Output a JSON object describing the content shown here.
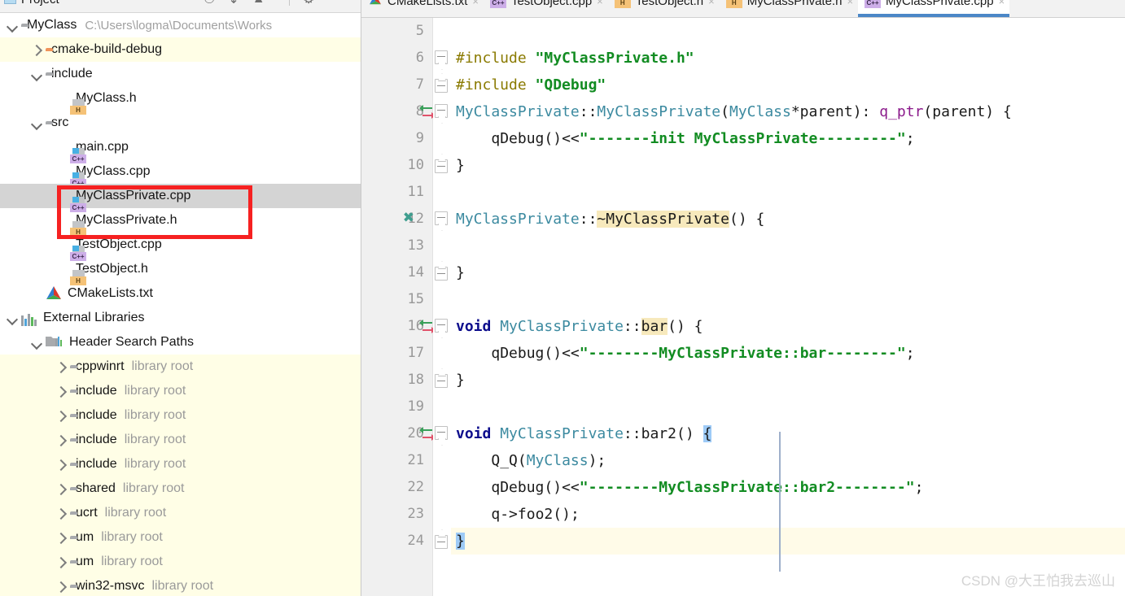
{
  "toolwindow": {
    "title": "Project",
    "caret_icon": "chevron-down-icon",
    "actions": [
      "locate-icon",
      "collapse-all-icon",
      "expand-icon",
      "settings-gear-icon"
    ]
  },
  "project_tree": [
    {
      "id": "myclass",
      "depth": 0,
      "arrow": "down",
      "icon": "folder-gray",
      "label": "MyClass",
      "path": "C:\\Users\\logma\\Documents\\Works",
      "row": "plain"
    },
    {
      "id": "cmake-build-debug",
      "depth": 1,
      "arrow": "right",
      "icon": "folder-orange",
      "label": "cmake-build-debug",
      "path": "",
      "row": "yellow"
    },
    {
      "id": "include",
      "depth": 1,
      "arrow": "down",
      "icon": "folder-gray",
      "label": "include",
      "path": "",
      "row": "plain"
    },
    {
      "id": "myclass-h",
      "depth": 2,
      "arrow": "none",
      "icon": "file-h",
      "label": "MyClass.h",
      "path": "",
      "row": "plain"
    },
    {
      "id": "src",
      "depth": 1,
      "arrow": "down",
      "icon": "folder-gray",
      "label": "src",
      "path": "",
      "row": "plain"
    },
    {
      "id": "main-cpp",
      "depth": 2,
      "arrow": "none",
      "icon": "file-cpp",
      "label": "main.cpp",
      "path": "",
      "row": "plain"
    },
    {
      "id": "myclass-cpp",
      "depth": 2,
      "arrow": "none",
      "icon": "file-cpp",
      "label": "MyClass.cpp",
      "path": "",
      "row": "plain"
    },
    {
      "id": "myclassprivate-cpp",
      "depth": 2,
      "arrow": "none",
      "icon": "file-cpp",
      "label": "MyClassPrivate.cpp",
      "path": "",
      "row": "selected"
    },
    {
      "id": "myclassprivate-h",
      "depth": 2,
      "arrow": "none",
      "icon": "file-h",
      "label": "MyClassPrivate.h",
      "path": "",
      "row": "plain"
    },
    {
      "id": "testobject-cpp",
      "depth": 2,
      "arrow": "none",
      "icon": "file-cpp",
      "label": "TestObject.cpp",
      "path": "",
      "row": "plain"
    },
    {
      "id": "testobject-h",
      "depth": 2,
      "arrow": "none",
      "icon": "file-h",
      "label": "TestObject.h",
      "path": "",
      "row": "plain"
    },
    {
      "id": "cmakelists-txt",
      "depth": 1,
      "arrow": "none",
      "icon": "cmake",
      "label": "CMakeLists.txt",
      "path": "",
      "row": "plain"
    },
    {
      "id": "external-libraries",
      "depth": 0,
      "arrow": "down",
      "icon": "libraries",
      "label": "External Libraries",
      "path": "",
      "row": "plain"
    },
    {
      "id": "header-search-paths",
      "depth": 1,
      "arrow": "down",
      "icon": "hsp",
      "label": "Header Search Paths",
      "path": "",
      "row": "plain"
    },
    {
      "id": "lib-cppwinrt",
      "depth": 2,
      "arrow": "right",
      "icon": "folder-gray",
      "label": "cppwinrt",
      "sub": "library root",
      "row": "yellow"
    },
    {
      "id": "lib-include-1",
      "depth": 2,
      "arrow": "right",
      "icon": "folder-gray",
      "label": "include",
      "sub": "library root",
      "row": "yellow"
    },
    {
      "id": "lib-include-2",
      "depth": 2,
      "arrow": "right",
      "icon": "folder-gray",
      "label": "include",
      "sub": "library root",
      "row": "yellow"
    },
    {
      "id": "lib-include-3",
      "depth": 2,
      "arrow": "right",
      "icon": "folder-gray",
      "label": "include",
      "sub": "library root",
      "row": "yellow"
    },
    {
      "id": "lib-include-4",
      "depth": 2,
      "arrow": "right",
      "icon": "folder-gray",
      "label": "include",
      "sub": "library root",
      "row": "yellow"
    },
    {
      "id": "lib-shared",
      "depth": 2,
      "arrow": "right",
      "icon": "folder-gray",
      "label": "shared",
      "sub": "library root",
      "row": "yellow"
    },
    {
      "id": "lib-ucrt",
      "depth": 2,
      "arrow": "right",
      "icon": "folder-gray",
      "label": "ucrt",
      "sub": "library root",
      "row": "yellow"
    },
    {
      "id": "lib-um-1",
      "depth": 2,
      "arrow": "right",
      "icon": "folder-gray",
      "label": "um",
      "sub": "library root",
      "row": "yellow"
    },
    {
      "id": "lib-um-2",
      "depth": 2,
      "arrow": "right",
      "icon": "folder-gray",
      "label": "um",
      "sub": "library root",
      "row": "yellow"
    },
    {
      "id": "lib-win32-msvc",
      "depth": 2,
      "arrow": "right",
      "icon": "folder-gray",
      "label": "win32-msvc",
      "sub": "library root",
      "row": "yellow"
    }
  ],
  "tabs": [
    {
      "id": "tab-cmakelists",
      "label": "CMakeLists.txt",
      "icon": "cmake",
      "active": false,
      "close": "×"
    },
    {
      "id": "tab-testobject-cpp",
      "label": "TestObject.cpp",
      "icon": "cpp",
      "active": false,
      "close": "×"
    },
    {
      "id": "tab-testobject-h",
      "label": "TestObject.h",
      "icon": "h",
      "active": false,
      "close": "×"
    },
    {
      "id": "tab-myclassprivate-h",
      "label": "MyClassPrivate.h",
      "icon": "h",
      "active": false,
      "close": "×"
    },
    {
      "id": "tab-myclassprivate-cpp",
      "label": "MyClassPrivate.cpp",
      "icon": "cpp",
      "active": true,
      "close": "×"
    }
  ],
  "editor": {
    "first_line": 5,
    "last_line": 24,
    "current_line": 24,
    "line_numbers": [
      "5",
      "6",
      "7",
      "8",
      "9",
      "10",
      "11",
      "12",
      "13",
      "14",
      "15",
      "16",
      "17",
      "18",
      "19",
      "20",
      "21",
      "22",
      "23",
      "24"
    ],
    "lines": [
      {
        "n": "5",
        "gutter": "",
        "fold": "",
        "text": ""
      },
      {
        "n": "6",
        "gutter": "",
        "fold": "open",
        "text": "#include \"MyClassPrivate.h\""
      },
      {
        "n": "7",
        "gutter": "",
        "fold": "close",
        "text": "#include \"QDebug\""
      },
      {
        "n": "8",
        "gutter": "arrow-pair",
        "fold": "open",
        "text": "MyClassPrivate::MyClassPrivate(MyClass*parent): q_ptr(parent) {"
      },
      {
        "n": "9",
        "gutter": "",
        "fold": "",
        "text": "    qDebug()<<\"-------init MyClassPrivate---------\";"
      },
      {
        "n": "10",
        "gutter": "",
        "fold": "close",
        "text": "}"
      },
      {
        "n": "11",
        "gutter": "",
        "fold": "",
        "text": ""
      },
      {
        "n": "12",
        "gutter": "x-mark",
        "fold": "open",
        "text": "MyClassPrivate::~MyClassPrivate() {"
      },
      {
        "n": "13",
        "gutter": "",
        "fold": "",
        "text": ""
      },
      {
        "n": "14",
        "gutter": "",
        "fold": "close",
        "text": "}"
      },
      {
        "n": "15",
        "gutter": "",
        "fold": "",
        "text": ""
      },
      {
        "n": "16",
        "gutter": "arrow-pair",
        "fold": "open",
        "text": "void MyClassPrivate::bar() {"
      },
      {
        "n": "17",
        "gutter": "",
        "fold": "",
        "text": "    qDebug()<<\"--------MyClassPrivate::bar--------\";"
      },
      {
        "n": "18",
        "gutter": "",
        "fold": "close",
        "text": "}"
      },
      {
        "n": "19",
        "gutter": "",
        "fold": "",
        "text": ""
      },
      {
        "n": "20",
        "gutter": "arrow-pair",
        "fold": "open",
        "text": "void MyClassPrivate::bar2() {"
      },
      {
        "n": "21",
        "gutter": "",
        "fold": "",
        "text": "    Q_Q(MyClass);"
      },
      {
        "n": "22",
        "gutter": "",
        "fold": "",
        "text": "    qDebug()<<\"--------MyClassPrivate::bar2--------\";"
      },
      {
        "n": "23",
        "gutter": "",
        "fold": "",
        "text": "    q->foo2();"
      },
      {
        "n": "24",
        "gutter": "",
        "fold": "close",
        "text": "}"
      }
    ],
    "highlighted_identifiers": [
      "~MyClassPrivate",
      "bar"
    ],
    "matched_braces": [
      "{",
      "}"
    ]
  },
  "watermark": "CSDN @大王怕我去巡山",
  "colors": {
    "accent_tab_underline": "#4b87c7",
    "selected_row": "#d4d4d4",
    "library_row": "#fffee6",
    "annotation_box": "#f62121",
    "current_line": "#fffbe8",
    "string_green": "#128c22",
    "keyword_blue": "#0d0d8c",
    "class_teal": "#3c8aa0",
    "field_magenta": "#8b1a8b",
    "preproc_olive": "#8a7a00",
    "identifier_highlight": "#f7e9bc",
    "brace_highlight": "#9ecbf7"
  }
}
